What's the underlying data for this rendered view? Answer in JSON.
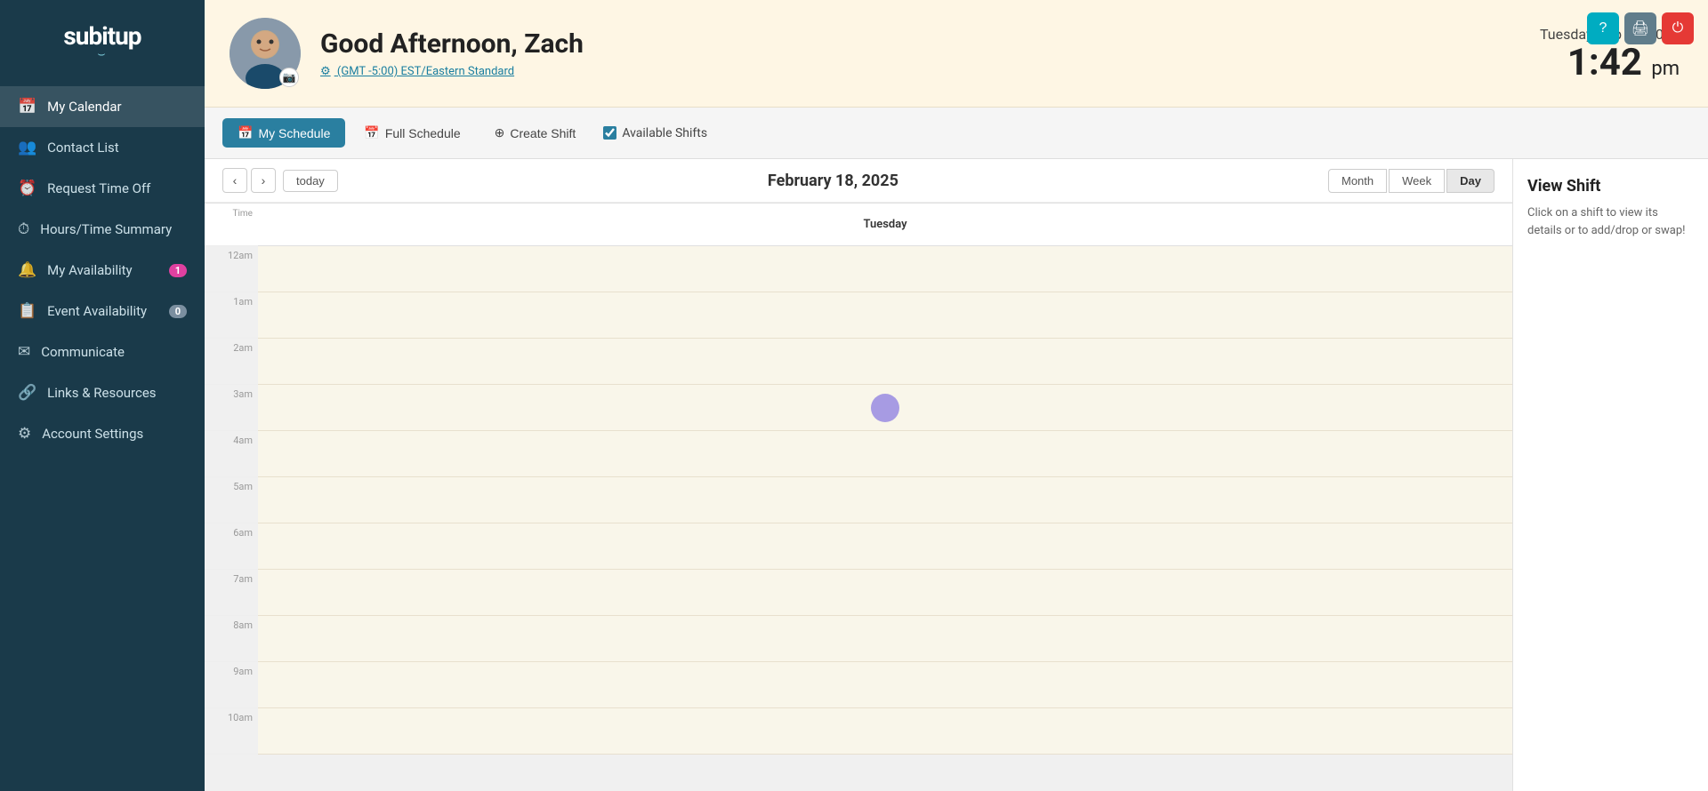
{
  "sidebar": {
    "logo": "subitup",
    "logo_smile": "⌣",
    "nav_items": [
      {
        "id": "my-calendar",
        "label": "My Calendar",
        "icon": "📅",
        "badge": null,
        "active": true
      },
      {
        "id": "contact-list",
        "label": "Contact List",
        "icon": "👥",
        "badge": null,
        "active": false
      },
      {
        "id": "request-time-off",
        "label": "Request Time Off",
        "icon": "⏰",
        "badge": null,
        "active": false
      },
      {
        "id": "hours-time-summary",
        "label": "Hours/Time Summary",
        "icon": "⏱",
        "badge": null,
        "active": false
      },
      {
        "id": "my-availability",
        "label": "My Availability",
        "icon": "🔔",
        "badge": "1",
        "badge_zero": false,
        "active": false
      },
      {
        "id": "event-availability",
        "label": "Event Availability",
        "icon": "📋",
        "badge": "0",
        "badge_zero": true,
        "active": false
      },
      {
        "id": "communicate",
        "label": "Communicate",
        "icon": "✉",
        "badge": null,
        "active": false
      },
      {
        "id": "links-resources",
        "label": "Links & Resources",
        "icon": "🔗",
        "badge": null,
        "active": false
      },
      {
        "id": "account-settings",
        "label": "Account Settings",
        "icon": "⚙",
        "badge": null,
        "active": false
      }
    ]
  },
  "topbar": {
    "buttons": [
      {
        "id": "help",
        "icon": "?",
        "color": "teal"
      },
      {
        "id": "print",
        "icon": "🖨",
        "color": "gray"
      },
      {
        "id": "power",
        "icon": "⏻",
        "color": "red"
      }
    ]
  },
  "header": {
    "greeting": "Good Afternoon, Zach",
    "timezone": "(GMT -5:00) EST/Eastern Standard",
    "date": "Tuesday, Feb 18, 2025",
    "time": "1:42",
    "ampm": "pm"
  },
  "tabs": [
    {
      "id": "my-schedule",
      "label": "My Schedule",
      "icon": "📅",
      "active": true
    },
    {
      "id": "full-schedule",
      "label": "Full Schedule",
      "icon": "📅",
      "active": false
    },
    {
      "id": "create-shift",
      "label": "Create Shift",
      "icon": "➕",
      "active": false
    }
  ],
  "available_shifts": {
    "label": "Available Shifts",
    "checked": true
  },
  "calendar": {
    "title": "February 18, 2025",
    "day_label": "Tuesday",
    "nav": {
      "prev": "‹",
      "next": "›",
      "today": "today"
    },
    "view_buttons": [
      {
        "id": "month",
        "label": "Month",
        "active": false
      },
      {
        "id": "week",
        "label": "Week",
        "active": false
      },
      {
        "id": "day",
        "label": "Day",
        "active": true
      }
    ],
    "time_slots": [
      "12am",
      "1am",
      "2am",
      "3am",
      "4am",
      "5am",
      "6am",
      "7am",
      "8am",
      "9am",
      "10am"
    ],
    "cursor_slot": "3am"
  },
  "right_panel": {
    "title": "View Shift",
    "description": "Click on a shift to view its details or to add/drop or swap!"
  }
}
